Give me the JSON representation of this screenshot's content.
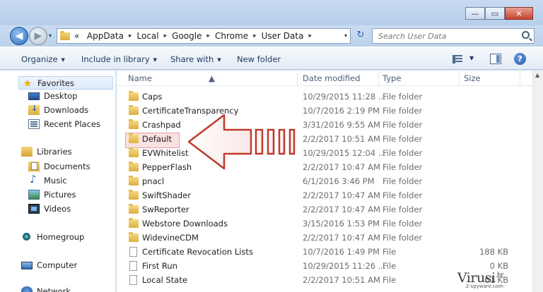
{
  "window": {
    "buttons": {
      "minimize": "—",
      "maximize": "▭",
      "close": "✕"
    }
  },
  "address": {
    "recent_glyph": "▾",
    "overflow": "«",
    "crumbs": [
      "AppData",
      "Local",
      "Google",
      "Chrome",
      "User Data"
    ],
    "separator": "▸",
    "dropdown": "▾",
    "refresh_glyph": "↻"
  },
  "search": {
    "placeholder": "Search User Data"
  },
  "nav_buttons": {
    "back": "◀",
    "forward": "▶"
  },
  "toolbar": {
    "organize": "Organize",
    "include_in_library": "Include in library",
    "share_with": "Share with",
    "new_folder": "New folder",
    "dropdown_glyph": "▼",
    "help": "?"
  },
  "navpane": {
    "favorites": "Favorites",
    "desktop": "Desktop",
    "downloads": "Downloads",
    "recent_places": "Recent Places",
    "libraries": "Libraries",
    "documents": "Documents",
    "music": "Music",
    "pictures": "Pictures",
    "videos": "Videos",
    "homegroup": "Homegroup",
    "computer": "Computer",
    "network": "Network"
  },
  "columns": {
    "name": "Name",
    "date_modified": "Date modified",
    "type": "Type",
    "size": "Size",
    "sort_glyph": "▲"
  },
  "files": [
    {
      "name": "Caps",
      "date": "10/29/2015 11:28 ...",
      "type": "File folder",
      "size": "",
      "kind": "folder"
    },
    {
      "name": "CertificateTransparency",
      "date": "10/7/2016 2:19 PM",
      "type": "File folder",
      "size": "",
      "kind": "folder"
    },
    {
      "name": "Crashpad",
      "date": "3/31/2016 9:55 AM",
      "type": "File folder",
      "size": "",
      "kind": "folder"
    },
    {
      "name": "Default",
      "date": "2/2/2017 10:51 AM",
      "type": "File folder",
      "size": "",
      "kind": "folder"
    },
    {
      "name": "EVWhitelist",
      "date": "10/29/2015 12:04 ...",
      "type": "File folder",
      "size": "",
      "kind": "folder"
    },
    {
      "name": "PepperFlash",
      "date": "2/2/2017 10:47 AM",
      "type": "File folder",
      "size": "",
      "kind": "folder"
    },
    {
      "name": "pnacl",
      "date": "6/1/2016 3:46 PM",
      "type": "File folder",
      "size": "",
      "kind": "folder"
    },
    {
      "name": "SwiftShader",
      "date": "2/2/2017 10:47 AM",
      "type": "File folder",
      "size": "",
      "kind": "folder"
    },
    {
      "name": "SwReporter",
      "date": "2/2/2017 10:47 AM",
      "type": "File folder",
      "size": "",
      "kind": "folder"
    },
    {
      "name": "Webstore Downloads",
      "date": "3/15/2016 1:53 PM",
      "type": "File folder",
      "size": "",
      "kind": "folder"
    },
    {
      "name": "WidevineCDM",
      "date": "2/2/2017 10:47 AM",
      "type": "File folder",
      "size": "",
      "kind": "folder"
    },
    {
      "name": "Certificate Revocation Lists",
      "date": "10/7/2016 1:49 PM",
      "type": "File",
      "size": "188 KB",
      "kind": "file"
    },
    {
      "name": "First Run",
      "date": "10/29/2015 11:26 ...",
      "type": "File",
      "size": "0 KB",
      "kind": "file"
    },
    {
      "name": "Local State",
      "date": "2/2/2017 10:51 AM",
      "type": "File",
      "size": "61 KB",
      "kind": "file"
    }
  ],
  "watermark": {
    "brand": "Virusi",
    "tld": ".hr",
    "sub": "2-spyware.com"
  },
  "colors": {
    "highlight": "#f0aaaa",
    "arrow": "#c0392b",
    "folder": "#e5bf55"
  }
}
